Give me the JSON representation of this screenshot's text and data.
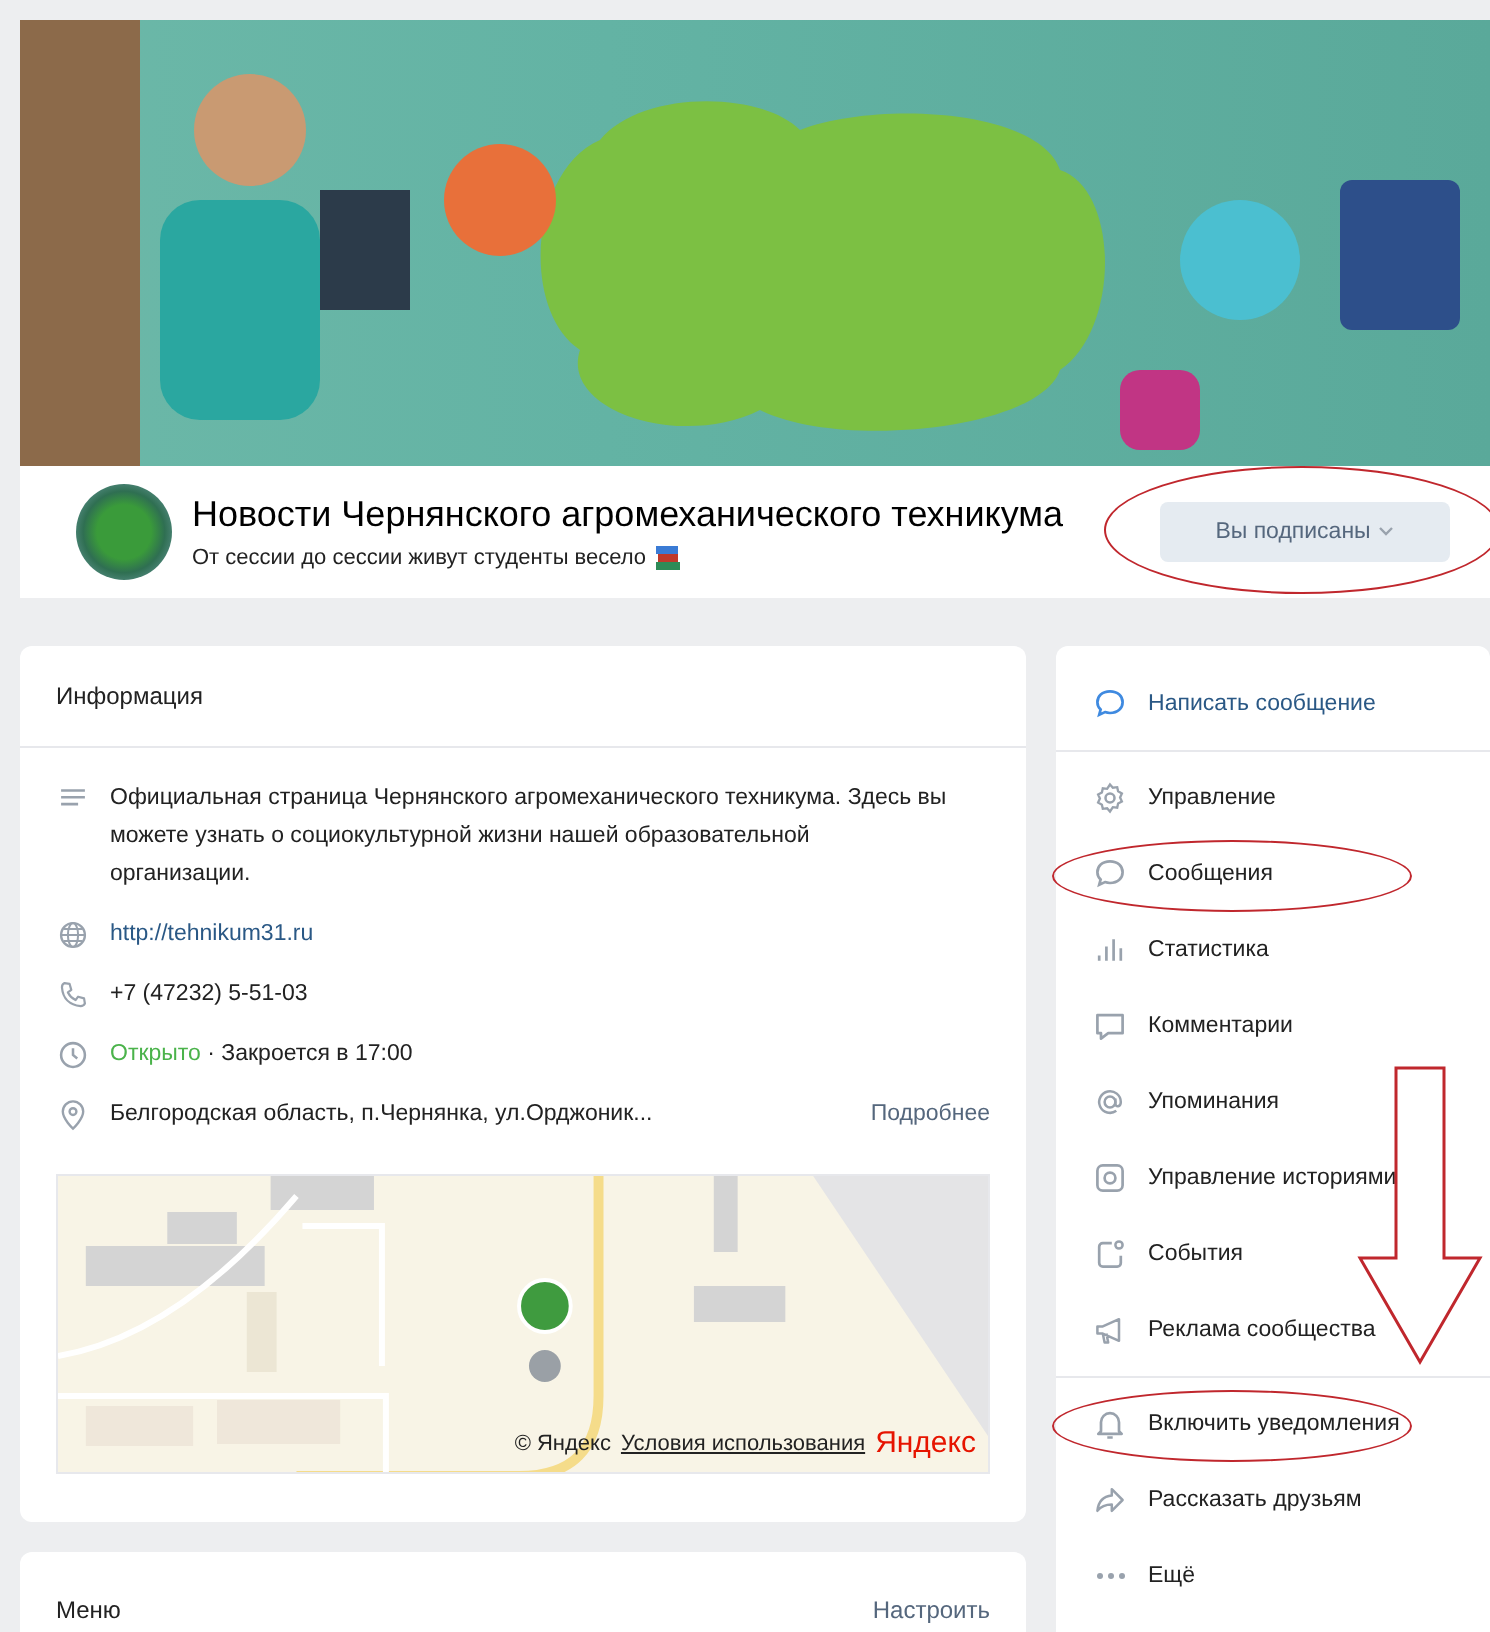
{
  "community": {
    "name": "Новости Чернянского агромеханического техникума",
    "status": "От сессии до сессии живут студенты весело",
    "subscribe_button": {
      "label": "Вы подписаны",
      "circled": true
    }
  },
  "info": {
    "title": "Информация",
    "rows": [
      {
        "kind": "description",
        "text": "Официальная страница Чернянского агромеханического техникума. Здесь вы можете узнать о социокультурной жизни нашей образовательной организации."
      },
      {
        "kind": "website",
        "text": "http://tehnikum31.ru"
      },
      {
        "kind": "phone",
        "text": "+7 (47232) 5-51-03"
      },
      {
        "kind": "hours",
        "open_label": "Открыто",
        "text": "· Закроется в 17:00"
      },
      {
        "kind": "address",
        "text": "Белгородская область, п.Чернянка, ул.Орджоник...",
        "more": "Подробнее"
      }
    ],
    "map": {
      "copyright": "© Яндекс",
      "terms": "Условия использования",
      "logo": "Яндекс"
    }
  },
  "menu_block": {
    "title": "Меню",
    "action": "Настроить"
  },
  "actions": [
    [
      {
        "label": "Написать сообщение",
        "primary": true,
        "circled": false,
        "arrow": false
      }
    ],
    [
      {
        "label": "Управление",
        "primary": false,
        "circled": false,
        "arrow": false
      },
      {
        "label": "Сообщения",
        "primary": false,
        "circled": true,
        "arrow": false
      },
      {
        "label": "Статистика",
        "primary": false,
        "circled": false,
        "arrow": false
      },
      {
        "label": "Комментарии",
        "primary": false,
        "circled": false,
        "arrow": false
      },
      {
        "label": "Упоминания",
        "primary": false,
        "circled": false,
        "arrow": false
      },
      {
        "label": "Управление историями",
        "primary": false,
        "circled": false,
        "arrow": false
      },
      {
        "label": "События",
        "primary": false,
        "circled": false,
        "arrow": false
      },
      {
        "label": "Реклама сообщества",
        "primary": false,
        "circled": false,
        "arrow": false
      }
    ],
    [
      {
        "label": "Включить уведомления",
        "primary": false,
        "circled": true,
        "arrow": true
      },
      {
        "label": "Рассказать друзьям",
        "primary": false,
        "circled": false,
        "arrow": false
      },
      {
        "label": "Ещё",
        "primary": false,
        "circled": false,
        "arrow": false
      }
    ]
  ]
}
